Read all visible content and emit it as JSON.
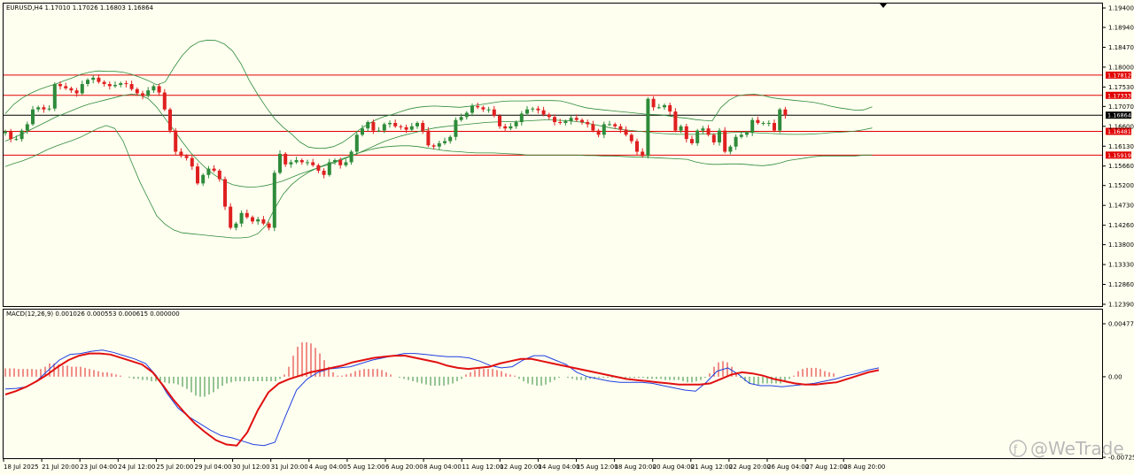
{
  "price_header": "EURUSD,H4  1.17010 1.17026 1.16803 1.16864",
  "macd_header": "MACD(12,26,9) 0.001026 0.000553 0.000615 0.000000",
  "watermark": "@WeTrade",
  "chart_data": [
    {
      "type": "candlestick",
      "symbol": "EURUSD",
      "timeframe": "H4",
      "ylim": [
        1.1239,
        1.194
      ],
      "y_ticks": [
        "1.19400",
        "1.18940",
        "1.18470",
        "1.18000",
        "1.17530",
        "1.17070",
        "1.16600",
        "1.16130",
        "1.15660",
        "1.15200",
        "1.14730",
        "1.14260",
        "1.13800",
        "1.13330",
        "1.12860",
        "1.12390"
      ],
      "x_tick_labels": [
        "18 Jul 2025",
        "21 Jul 20:00",
        "23 Jul 04:00",
        "24 Jul 12:00",
        "25 Jul 20:00",
        "29 Jul 04:00",
        "30 Jul 12:00",
        "31 Jul 20:00",
        "4 Aug 04:00",
        "5 Aug 12:00",
        "6 Aug 20:00",
        "8 Aug 04:00",
        "11 Aug 12:00",
        "12 Aug 20:00",
        "14 Aug 04:00",
        "15 Aug 12:00",
        "18 Aug 20:00",
        "20 Aug 04:00",
        "21 Aug 12:00",
        "22 Aug 20:00",
        "26 Aug 04:00",
        "27 Aug 12:00",
        "28 Aug 20:00"
      ],
      "horizontal_levels": [
        {
          "value": 1.17812,
          "label": "1.17812",
          "color": "#e00000"
        },
        {
          "value": 1.17333,
          "label": "1.17333",
          "color": "#e00000"
        },
        {
          "value": 1.16864,
          "label": "1.16864",
          "color": "#000000"
        },
        {
          "value": 1.16481,
          "label": "1.16481",
          "color": "#e00000"
        },
        {
          "value": 1.15919,
          "label": "1.15919",
          "color": "#e00000"
        }
      ],
      "colors": {
        "bull": "#2e8b3a",
        "bear": "#e02020",
        "bands": "#2e8b3a"
      },
      "close_series": [
        1.1648,
        1.163,
        1.163,
        1.165,
        1.1665,
        1.17,
        1.1705,
        1.17,
        1.1702,
        1.176,
        1.1755,
        1.175,
        1.1745,
        1.1738,
        1.176,
        1.177,
        1.1775,
        1.1765,
        1.176,
        1.1755,
        1.1758,
        1.1762,
        1.176,
        1.1748,
        1.1738,
        1.1732,
        1.1745,
        1.1755,
        1.174,
        1.17,
        1.165,
        1.16,
        1.159,
        1.1585,
        1.1565,
        1.1525,
        1.1545,
        1.156,
        1.1555,
        1.1535,
        1.147,
        1.142,
        1.143,
        1.1455,
        1.1445,
        1.1435,
        1.144,
        1.143,
        1.142,
        1.155,
        1.1595,
        1.157,
        1.1575,
        1.158,
        1.1575,
        1.1575,
        1.1568,
        1.1555,
        1.1545,
        1.1575,
        1.158,
        1.1568,
        1.1575,
        1.16,
        1.164,
        1.1655,
        1.167,
        1.165,
        1.165,
        1.1665,
        1.1668,
        1.166,
        1.1658,
        1.1652,
        1.166,
        1.1668,
        1.165,
        1.1615,
        1.1612,
        1.162,
        1.1625,
        1.1635,
        1.1675,
        1.1682,
        1.1692,
        1.1708,
        1.1705,
        1.17,
        1.17,
        1.1685,
        1.166,
        1.1655,
        1.166,
        1.167,
        1.169,
        1.17,
        1.1702,
        1.1698,
        1.1688,
        1.1682,
        1.167,
        1.1668,
        1.1672,
        1.168,
        1.1675,
        1.167,
        1.1665,
        1.165,
        1.164,
        1.1665,
        1.1665,
        1.166,
        1.1652,
        1.164,
        1.1625,
        1.16,
        1.159,
        1.1725,
        1.1705,
        1.1705,
        1.171,
        1.1695,
        1.165,
        1.166,
        1.163,
        1.162,
        1.165,
        1.1655,
        1.164,
        1.1622,
        1.165,
        1.16,
        1.1612,
        1.1635,
        1.164,
        1.1645,
        1.1675,
        1.1668,
        1.1668,
        1.1668,
        1.165,
        1.17,
        1.1686
      ],
      "bollinger_upper": [
        1.169,
        1.1712,
        1.1727,
        1.1738,
        1.1747,
        1.1754,
        1.176,
        1.1768,
        1.1775,
        1.1783,
        1.1788,
        1.1791,
        1.179,
        1.179,
        1.1788,
        1.1783,
        1.1776,
        1.1768,
        1.1758,
        1.1765,
        1.1798,
        1.1827,
        1.1848,
        1.186,
        1.1864,
        1.1863,
        1.1855,
        1.1838,
        1.1808,
        1.1768,
        1.1735,
        1.1705,
        1.1678,
        1.1658,
        1.1642,
        1.1623,
        1.1611,
        1.1608,
        1.1608,
        1.1612,
        1.1621,
        1.1635,
        1.1651,
        1.1664,
        1.1675,
        1.1683,
        1.1688,
        1.1695,
        1.1701,
        1.1705,
        1.1707,
        1.1708,
        1.1707,
        1.1706,
        1.1705,
        1.1707,
        1.171,
        1.1713,
        1.1716,
        1.1719,
        1.172,
        1.172,
        1.172,
        1.1721,
        1.1721,
        1.1721,
        1.172,
        1.1715,
        1.1709,
        1.1704,
        1.1701,
        1.1699,
        1.1697,
        1.1695,
        1.1693,
        1.1691,
        1.1689,
        1.1688,
        1.1687,
        1.1684,
        1.1681,
        1.1679,
        1.1676,
        1.1674,
        1.1673,
        1.1704,
        1.1722,
        1.1732,
        1.1735,
        1.1736,
        1.1733,
        1.1728,
        1.1725,
        1.1723,
        1.1721,
        1.1719,
        1.1717,
        1.1713,
        1.1708,
        1.1704,
        1.1701,
        1.1698,
        1.1699,
        1.1706
      ],
      "bollinger_middle": [
        1.1625,
        1.1633,
        1.1642,
        1.1652,
        1.1662,
        1.1672,
        1.1682,
        1.169,
        1.1698,
        1.1706,
        1.1713,
        1.1718,
        1.1723,
        1.1728,
        1.1733,
        1.1736,
        1.1734,
        1.1725,
        1.1705,
        1.1678,
        1.1652,
        1.1624,
        1.1598,
        1.1577,
        1.1558,
        1.1543,
        1.1531,
        1.1522,
        1.1518,
        1.1516,
        1.1517,
        1.152,
        1.1525,
        1.1531,
        1.1539,
        1.1547,
        1.1554,
        1.1561,
        1.1567,
        1.1573,
        1.1581,
        1.1589,
        1.1597,
        1.1606,
        1.1615,
        1.1624,
        1.1631,
        1.1637,
        1.1642,
        1.1647,
        1.1652,
        1.1656,
        1.1659,
        1.1661,
        1.1663,
        1.1665,
        1.1667,
        1.1669,
        1.167,
        1.1671,
        1.1671,
        1.1672,
        1.1673,
        1.1674,
        1.1675,
        1.1675,
        1.1674,
        1.1673,
        1.1671,
        1.1668,
        1.1664,
        1.166,
        1.1656,
        1.1653,
        1.1651,
        1.1649,
        1.1647,
        1.1645,
        1.1643,
        1.1642,
        1.1641,
        1.1641,
        1.1641,
        1.1642,
        1.1642,
        1.1643,
        1.1645,
        1.1646,
        1.1646,
        1.1645,
        1.1644,
        1.1643,
        1.1642,
        1.1641,
        1.1641,
        1.1641,
        1.1642,
        1.1643,
        1.1645,
        1.1646,
        1.1647,
        1.1649,
        1.1652,
        1.1656
      ],
      "bollinger_lower": [
        1.1565,
        1.1572,
        1.1578,
        1.1586,
        1.1595,
        1.1605,
        1.1613,
        1.162,
        1.1627,
        1.1635,
        1.1645,
        1.1655,
        1.1662,
        1.1655,
        1.1625,
        1.1575,
        1.1528,
        1.1488,
        1.1448,
        1.1428,
        1.1415,
        1.1408,
        1.1406,
        1.1404,
        1.1402,
        1.14,
        1.1398,
        1.1396,
        1.1396,
        1.1398,
        1.1406,
        1.1426,
        1.1465,
        1.1499,
        1.1522,
        1.1538,
        1.1551,
        1.1561,
        1.1569,
        1.1576,
        1.1583,
        1.159,
        1.1597,
        1.1603,
        1.1608,
        1.1611,
        1.1613,
        1.1614,
        1.1614,
        1.1612,
        1.1609,
        1.1606,
        1.1603,
        1.1601,
        1.16,
        1.1598,
        1.1597,
        1.1597,
        1.1597,
        1.1596,
        1.1595,
        1.1594,
        1.1592,
        1.1592,
        1.1592,
        1.1592,
        1.1592,
        1.1592,
        1.1592,
        1.1591,
        1.1591,
        1.159,
        1.159,
        1.1589,
        1.1588,
        1.1587,
        1.1587,
        1.1586,
        1.1585,
        1.1584,
        1.1583,
        1.1582,
        1.1576,
        1.1572,
        1.157,
        1.157,
        1.1571,
        1.1571,
        1.157,
        1.1568,
        1.1567,
        1.1569,
        1.1573,
        1.1579,
        1.1582,
        1.1585,
        1.1588,
        1.159,
        1.159,
        1.159,
        1.159,
        1.159,
        1.1592,
        1.1592
      ]
    },
    {
      "type": "macd",
      "params": "12,26,9",
      "ylim": [
        -0.007257,
        0.004774
      ],
      "y_ticks": [
        "0.004774",
        "0.00",
        "-0.007257"
      ],
      "colors": {
        "histogram_pos": "#e02020",
        "histogram_neg": "#2e8b3a",
        "macd_line": "#1f3fe0",
        "signal_line": "#e01010"
      },
      "histogram": [
        0.00075,
        0.00075,
        0.00075,
        0.0007,
        0.0007,
        0.0007,
        0.0007,
        0.00065,
        0.0007,
        0.0009,
        0.0012,
        0.0012,
        0.0011,
        0.001,
        0.001,
        0.0009,
        0.0009,
        0.0009,
        0.0008,
        0.0007,
        0.0006,
        0.0005,
        0.0004,
        0.0004,
        0.0003,
        0.0002,
        0.0001,
        0,
        -0.0001,
        -0.0002,
        -0.0002,
        -0.0003,
        -0.0003,
        -0.0004,
        -0.0004,
        -0.0005,
        -0.0005,
        -0.0006,
        -0.0006,
        -0.0007,
        -0.0009,
        -0.0011,
        -0.0014,
        -0.0017,
        -0.0018,
        -0.0018,
        -0.0016,
        -0.0014,
        -0.0011,
        -0.0008,
        -0.0006,
        -0.0005,
        -0.0004,
        -0.0004,
        -0.0004,
        -0.0004,
        -0.0004,
        -0.0004,
        -0.0004,
        -0.0004,
        -0.0004,
        -0.0004,
        -0.0002,
        0.0002,
        0.0009,
        0.0019,
        0.0027,
        0.0031,
        0.0031,
        0.003,
        0.0026,
        0.0021,
        0.0015,
        0.0009,
        0.0004,
        0.0001,
        0.0001,
        0.0002,
        0.0003,
        0.0005,
        0.0006,
        0.0007,
        0.0007,
        0.0007,
        0.0007,
        0.0006,
        0.0004,
        0.0002,
        0,
        -0.0001,
        -0.0002,
        -0.0003,
        -0.0004,
        -0.0005,
        -0.0006,
        -0.0007,
        -0.0008,
        -0.0008,
        -0.0008,
        -0.0008,
        -0.0007,
        -0.0006,
        -0.0004,
        -0.0002,
        0.0002,
        0.0004,
        0.0006,
        0.0007,
        0.0007,
        0.0007,
        0.0007,
        0.0006,
        0.0005,
        0.0003,
        0.0002,
        0.0001,
        -0.0002,
        -0.0004,
        -0.0006,
        -0.0007,
        -0.0008,
        -0.0008,
        -0.0007,
        -0.0005,
        -0.0003,
        -0.0001,
        0,
        -0.0001,
        -0.0002,
        -0.0003,
        -0.0003,
        -0.0003,
        -0.0002,
        -0.0002,
        -0.0001,
        -0.0001,
        -0.0001,
        -0.0001,
        -0.0001,
        -0.0001,
        -0.0001,
        -0.0001,
        -0.0001,
        -0.0001,
        -0.0001,
        -0.0002,
        -0.0002,
        -0.0002,
        -0.0002,
        -0.0003,
        -0.0003,
        -0.0003,
        -0.0003,
        -0.0004,
        -0.0005,
        -0.0005,
        -0.0004,
        -0.0003,
        -0.0001,
        0.0003,
        0.0009,
        0.0013,
        0.0014,
        0.0013,
        0.0009,
        0.0004,
        -0.0001,
        -0.0004,
        -0.0006,
        -0.0007,
        -0.0007,
        -0.0006,
        -0.0006,
        -0.0006,
        -0.0006,
        -0.0006,
        -0.0004,
        -0.0002,
        0.0001,
        0.0005,
        0.0007,
        0.0008,
        0.0008,
        0.0008,
        0.0007,
        0.0005,
        0.0004,
        0.0003
      ],
      "macd_line": [
        -0.0011,
        -0.00105,
        -0.0009,
        -0.0003,
        0.0006,
        0.0015,
        0.002,
        0.0021,
        0.0023,
        0.0024,
        0.0022,
        0.0019,
        0.0016,
        0.0012,
        0.0001,
        -0.0015,
        -0.0028,
        -0.0036,
        -0.0042,
        -0.0048,
        -0.0053,
        -0.0055,
        -0.0058,
        -0.0061,
        -0.0062,
        -0.0059,
        -0.0035,
        -0.0012,
        -0.0002,
        0.0004,
        0.0007,
        0.0008,
        0.0009,
        0.0012,
        0.0015,
        0.0017,
        0.0019,
        0.0021,
        0.0021,
        0.002,
        0.0019,
        0.0018,
        0.0018,
        0.0017,
        0.0014,
        0.001,
        0.0008,
        0.0009,
        0.0015,
        0.0019,
        0.0019,
        0.0015,
        0.0011,
        0.0004,
        0.0,
        -0.0002,
        -0.0004,
        -0.0005,
        -0.0005,
        -0.0005,
        -0.0006,
        -0.0008,
        -0.001,
        -0.0012,
        -0.0013,
        -0.0005,
        0.0005,
        0.0008,
        0.0002,
        -0.0006,
        -0.0008,
        -0.0008,
        -0.0009,
        -0.0008,
        -0.0007,
        -0.0006,
        -0.0004,
        -0.0002,
        0.0001,
        0.0003,
        0.0006,
        0.0008
      ],
      "signal_line": [
        -0.0016,
        -0.0013,
        -0.0009,
        -0.0004,
        0.0002,
        0.0009,
        0.0015,
        0.0019,
        0.0021,
        0.0021,
        0.002,
        0.0017,
        0.0014,
        0.0011,
        0.0004,
        -0.0008,
        -0.0021,
        -0.0032,
        -0.0042,
        -0.005,
        -0.0057,
        -0.0061,
        -0.0062,
        -0.005,
        -0.003,
        -0.0014,
        -0.0006,
        -0.0002,
        0.0001,
        0.0004,
        0.0006,
        0.0008,
        0.001,
        0.0013,
        0.0015,
        0.0017,
        0.0018,
        0.0019,
        0.0019,
        0.0017,
        0.0015,
        0.0013,
        0.001,
        0.0008,
        0.0007,
        0.0008,
        0.0009,
        0.0012,
        0.0014,
        0.0016,
        0.0016,
        0.0014,
        0.0012,
        0.001,
        0.0008,
        0.0006,
        0.0004,
        0.0002,
        0.0,
        -0.0002,
        -0.0003,
        -0.0004,
        -0.0005,
        -0.0006,
        -0.0007,
        -0.0007,
        -0.0007,
        -0.0006,
        -0.0002,
        0.0002,
        0.0004,
        0.0003,
        0.0001,
        -0.0002,
        -0.0004,
        -0.0006,
        -0.0007,
        -0.0007,
        -0.0006,
        -0.0005,
        -0.0002,
        0.0001,
        0.0004,
        0.0006
      ]
    }
  ]
}
